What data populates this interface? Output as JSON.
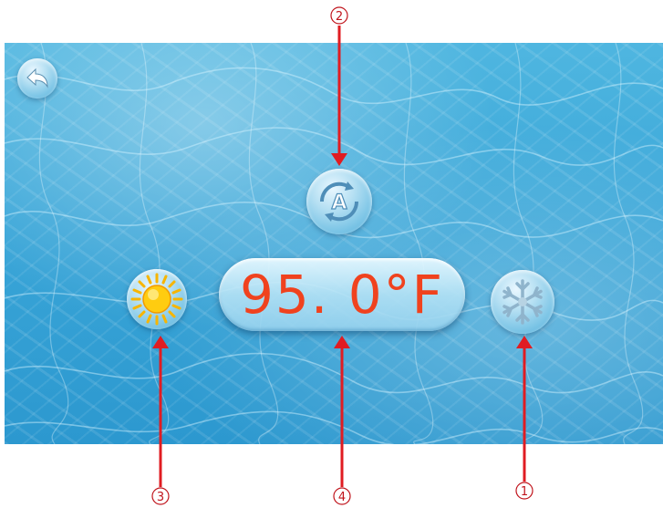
{
  "display": {
    "temperature": "95. 0°F"
  },
  "buttons": {
    "back_icon": "back-arrow-icon",
    "auto_icon": "auto-mode-icon",
    "auto_letter": "A",
    "heat_icon": "sun-icon",
    "cool_icon": "snowflake-icon"
  },
  "callouts": {
    "cool": "1",
    "auto": "2",
    "heat": "3",
    "temperature": "4"
  },
  "colors": {
    "water": "#3aa6d8",
    "temperature_text": "#f0421e",
    "callout": "#c0141c"
  }
}
